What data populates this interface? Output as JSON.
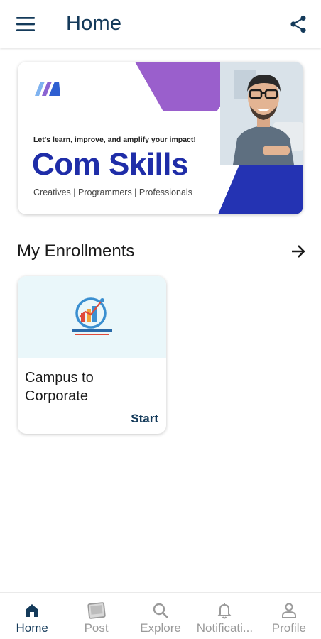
{
  "header": {
    "title": "Home",
    "menu_icon": "hamburger-menu-icon",
    "share_icon": "share-icon"
  },
  "banner": {
    "tagline": "Let's learn, improve, and amplify your impact!",
    "title": "Com Skills",
    "subtitle": "Creatives | Programmers | Professionals",
    "colors": {
      "purple": "#9a5fcc",
      "blue": "#2433b3",
      "title": "#1f2da8"
    }
  },
  "enrollments": {
    "title": "My Enrollments",
    "arrow_icon": "arrow-right-icon",
    "courses": [
      {
        "name": "Campus to Corporate",
        "action": "Start",
        "logo": "career-compass-logo"
      }
    ]
  },
  "bottom_nav": {
    "items": [
      {
        "label": "Home",
        "icon": "home-icon",
        "active": true
      },
      {
        "label": "Post",
        "icon": "post-icon",
        "active": false
      },
      {
        "label": "Explore",
        "icon": "search-icon",
        "active": false
      },
      {
        "label": "Notificati...",
        "icon": "bell-icon",
        "active": false
      },
      {
        "label": "Profile",
        "icon": "person-icon",
        "active": false
      }
    ]
  },
  "colors": {
    "primary": "#143a5a",
    "inactive": "#9a9a9a"
  }
}
